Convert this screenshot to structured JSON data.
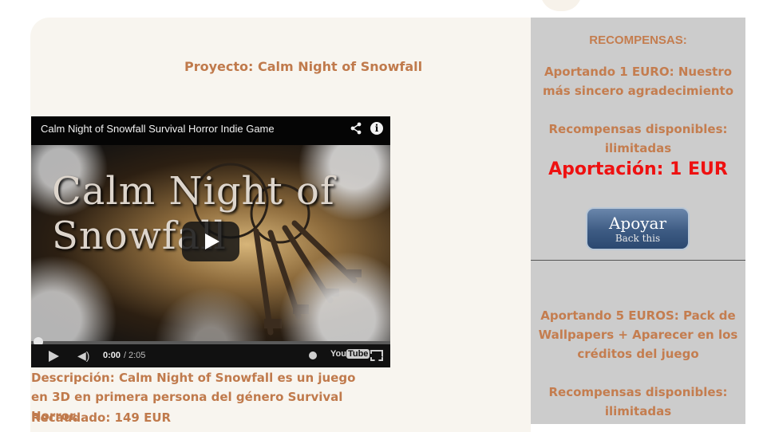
{
  "project": {
    "title": "Proyecto: Calm Night of Snowfall"
  },
  "video": {
    "title": "Calm Night of Snowfall Survival Horror Indie Game",
    "art_title": "Calm Night of Snowfall",
    "current_time": "0:00",
    "separator": "/",
    "duration": "2:05",
    "youtube_label": "You",
    "youtube_label_box": "Tube",
    "progress": 0
  },
  "project_info": {
    "description": "Descripción: Calm Night of Snowfall es un juego en 3D en primera persona del género Survival Horror.",
    "raised": "Recaudado: 149 EUR"
  },
  "rewards": {
    "heading": "RECOMPENSAS:",
    "tier1": {
      "title": "Aportando 1 EURO: Nuestro más sincero agradecimiento",
      "available": "Recompensas disponibles: ilimitadas",
      "contribution": "Aportación: 1 EUR",
      "button_main": "Apoyar",
      "button_sub": "Back this"
    },
    "tier2": {
      "title": "Aportando 5 EUROS: Pack de Wallpapers + Aparecer en los créditos del juego",
      "available": "Recompensas disponibles: ilimitadas"
    }
  },
  "colors": {
    "accent_text": "#c07a4c",
    "contribution": "#ee1111",
    "rewards_bg": "#cccccc",
    "panel_bg": "#f8f5ef"
  },
  "icons": [
    "share-icon",
    "info-icon",
    "play-icon",
    "volume-icon",
    "clock-icon",
    "fullscreen-icon"
  ]
}
